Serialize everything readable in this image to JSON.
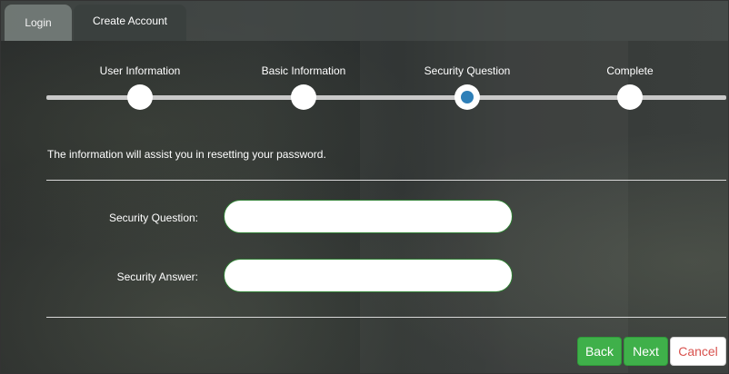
{
  "tabs": [
    {
      "label": "Login",
      "active": false
    },
    {
      "label": "Create Account",
      "active": true
    }
  ],
  "stepper": {
    "steps": [
      {
        "label": "User Information",
        "state": "done"
      },
      {
        "label": "Basic Information",
        "state": "done"
      },
      {
        "label": "Security Question",
        "state": "current"
      },
      {
        "label": "Complete",
        "state": "pending"
      }
    ]
  },
  "form": {
    "info_text": "The information will assist you in resetting your password.",
    "security_question_label": "Security Question:",
    "security_question_value": "",
    "security_answer_label": "Security Answer:",
    "security_answer_value": ""
  },
  "buttons": {
    "back_label": "Back",
    "next_label": "Next",
    "cancel_label": "Cancel"
  },
  "colors": {
    "primary_button": "#3fb04a",
    "cancel_text": "#d9534f",
    "active_step_dot": "#2e7fb8",
    "input_border": "#2e7d32"
  }
}
